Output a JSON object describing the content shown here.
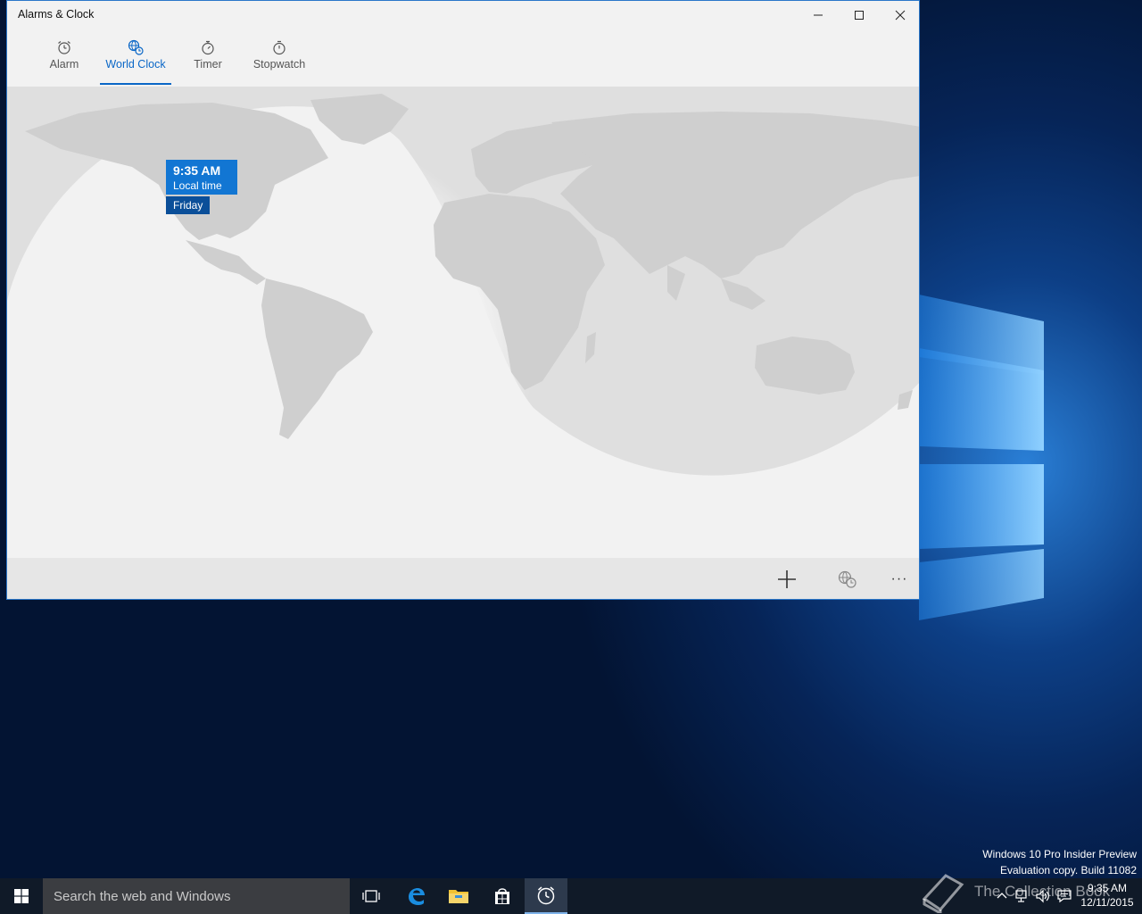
{
  "window": {
    "title": "Alarms & Clock"
  },
  "tabs": [
    {
      "label": "Alarm",
      "icon": "alarm-clock-icon",
      "active": false
    },
    {
      "label": "World Clock",
      "icon": "world-clock-icon",
      "active": true
    },
    {
      "label": "Timer",
      "icon": "timer-icon",
      "active": false
    },
    {
      "label": "Stopwatch",
      "icon": "stopwatch-icon",
      "active": false
    }
  ],
  "map": {
    "local_clock": {
      "time": "9:35 AM",
      "label": "Local time",
      "day": "Friday"
    }
  },
  "appbar": {
    "add_icon": "plus-icon",
    "compare_icon": "compare-clock-icon",
    "more_label": "···"
  },
  "watermark": {
    "line1": "Windows 10 Pro Insider Preview",
    "line2": "Evaluation copy. Build 11082"
  },
  "taskbar": {
    "search_placeholder": "Search the web and Windows",
    "clock_time": "9:35 AM",
    "clock_date": "12/11/2015"
  },
  "overlay": {
    "logo_text": "The Collection Book"
  },
  "colors": {
    "accent": "#0a67c7",
    "time_card": "#1276d3",
    "day_card": "#0b4f99",
    "land": "#cfcfcf",
    "night": "#dcdcdc"
  }
}
